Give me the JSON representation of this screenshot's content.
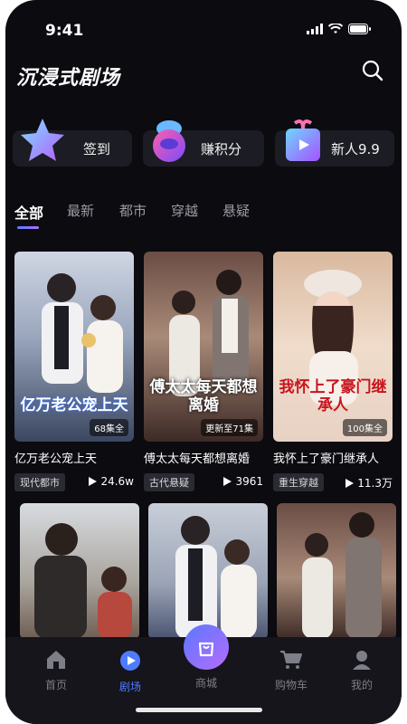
{
  "status": {
    "time": "9:41"
  },
  "header": {
    "title": "沉浸式剧场"
  },
  "promos": [
    {
      "label": "签到",
      "icon": "star-icon"
    },
    {
      "label": "赚积分",
      "icon": "points-icon"
    },
    {
      "label": "新人9.9",
      "icon": "gift-icon"
    }
  ],
  "tabs": [
    "全部",
    "最新",
    "都市",
    "穿越",
    "悬疑"
  ],
  "active_tab": "全部",
  "dramas": [
    {
      "poster_title": "亿万老公宠上天",
      "episodes": "68集全",
      "name": "亿万老公宠上天",
      "tag": "现代都市",
      "plays": "24.6w"
    },
    {
      "poster_title": "傅太太每天都想离婚",
      "episodes": "更新至71集",
      "name": "傅太太每天都想离婚",
      "tag": "古代悬疑",
      "plays": "3961"
    },
    {
      "poster_title": "我怀上了豪门继承人",
      "episodes": "100集全",
      "name": "我怀上了豪门继承人",
      "tag": "重生穿越",
      "plays": "11.3万"
    }
  ],
  "tabbar": {
    "home": "首页",
    "theater": "剧场",
    "mall": "商城",
    "cart": "购物车",
    "mine": "我的"
  },
  "colors": {
    "accent": "#4e7bff",
    "background": "#0b0b10"
  }
}
